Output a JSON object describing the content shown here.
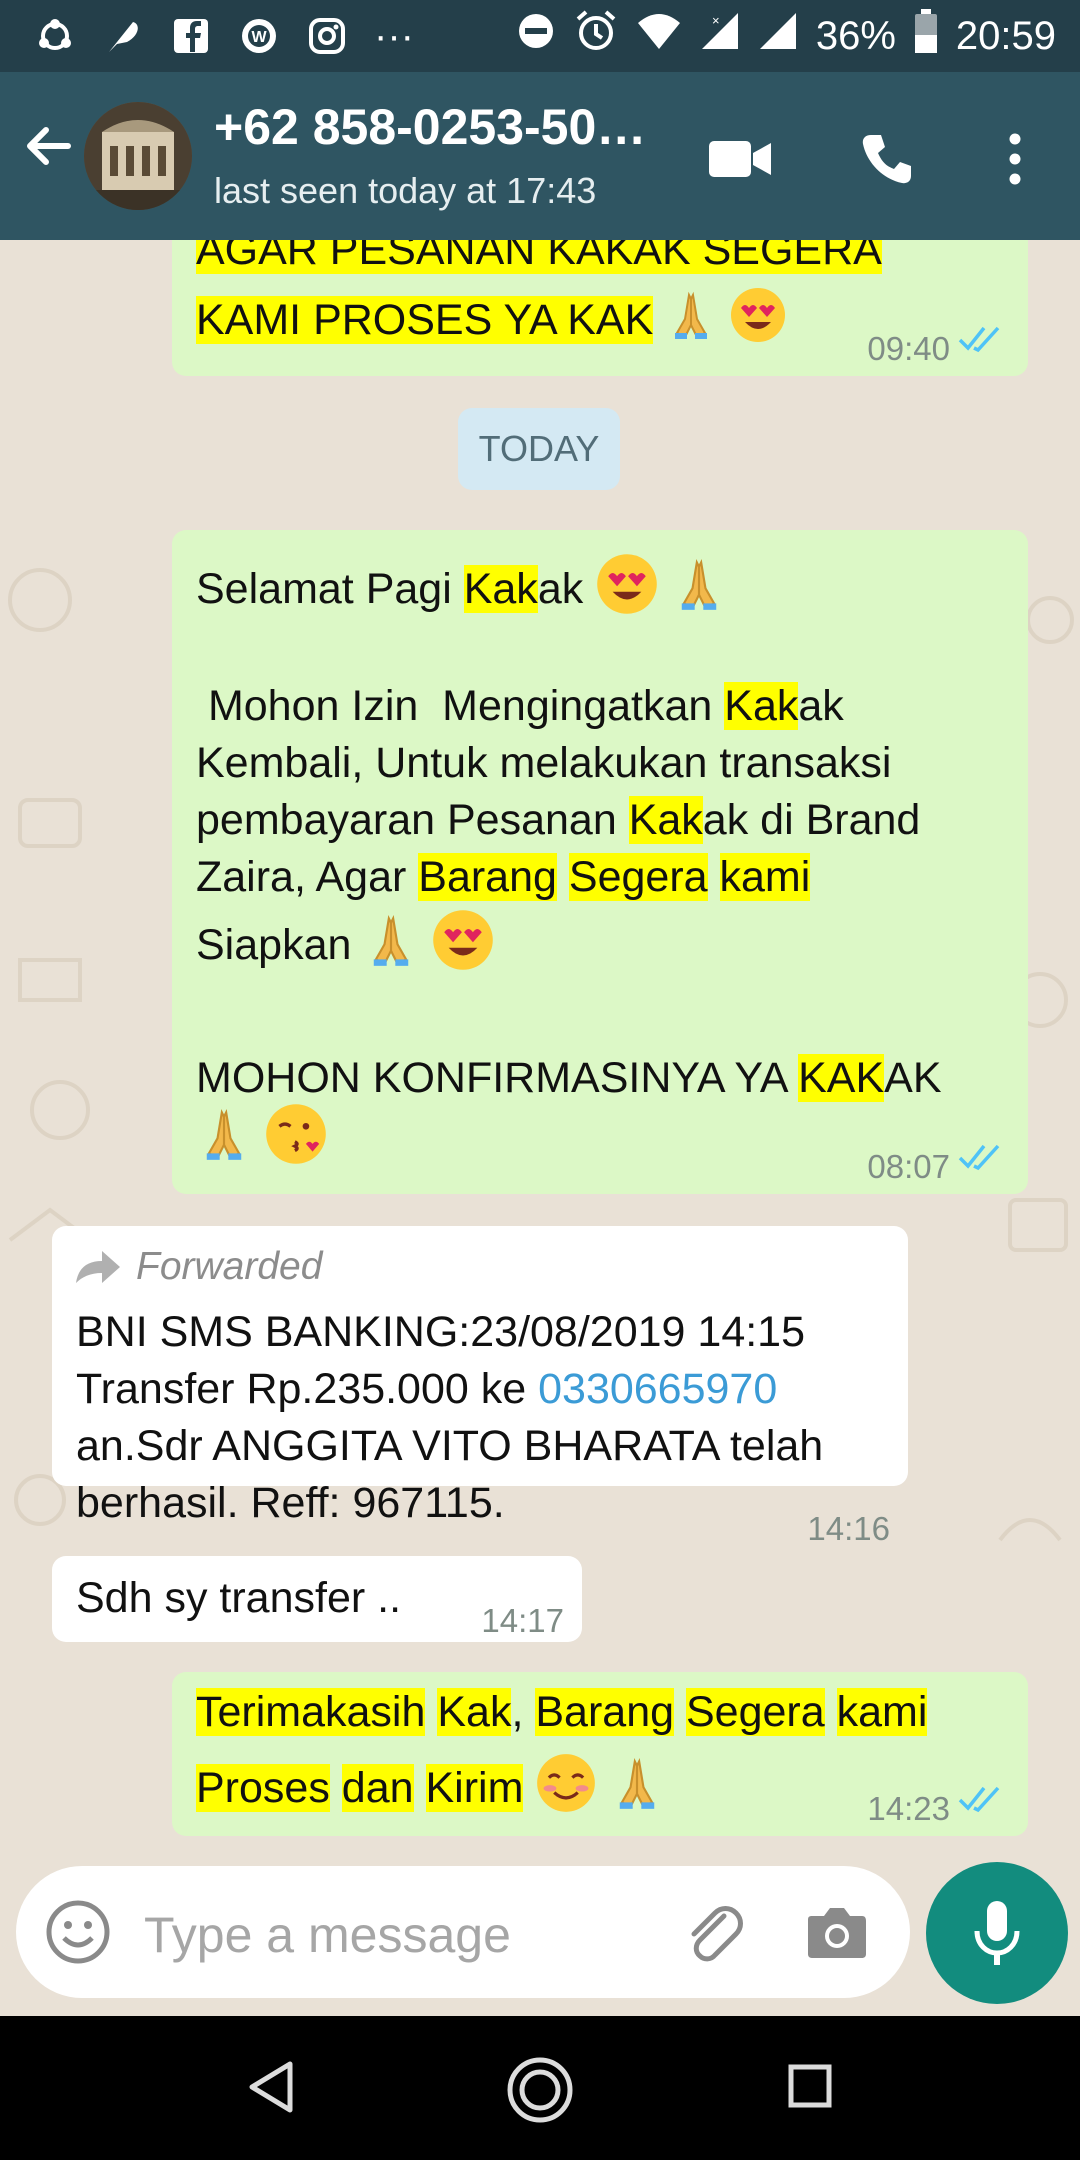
{
  "status_bar": {
    "battery": "36%",
    "clock": "20:59",
    "more": "···"
  },
  "header": {
    "contact": "+62 858-0253-50…",
    "last_seen": "last seen today at 17:43"
  },
  "chat": {
    "date_divider": "TODAY",
    "messages": [
      {
        "type": "outgoing",
        "lines": [
          "AGAR PESANAN KAKAK SEGERA",
          "KAMI PROSES YA KAK"
        ],
        "time": "09:40"
      },
      {
        "type": "outgoing",
        "time": "08:07"
      },
      {
        "type": "incoming",
        "forwarded_label": "Forwarded",
        "line1": "BNI SMS BANKING:23/08/2019 14:15",
        "line2_prefix": "Transfer Rp.235.000 ke ",
        "line2_link": "0330665970",
        "line3": "an.Sdr ANGGITA VITO BHARATA telah",
        "line4": "berhasil. Reff: 967115.",
        "time": "14:16"
      },
      {
        "type": "incoming",
        "text": "Sdh sy transfer ..",
        "time": "14:17"
      },
      {
        "type": "outgoing",
        "time": "14:23"
      }
    ]
  },
  "composer": {
    "placeholder": "Type a message"
  },
  "colors": {
    "header": "#2f5562",
    "status_bar": "#243f4a",
    "outgoing_bubble": "#dcf8c6",
    "incoming_bubble": "#ffffff",
    "highlight": "#ffff00",
    "fab": "#128c7e",
    "read_ticks": "#4fc3f7"
  }
}
